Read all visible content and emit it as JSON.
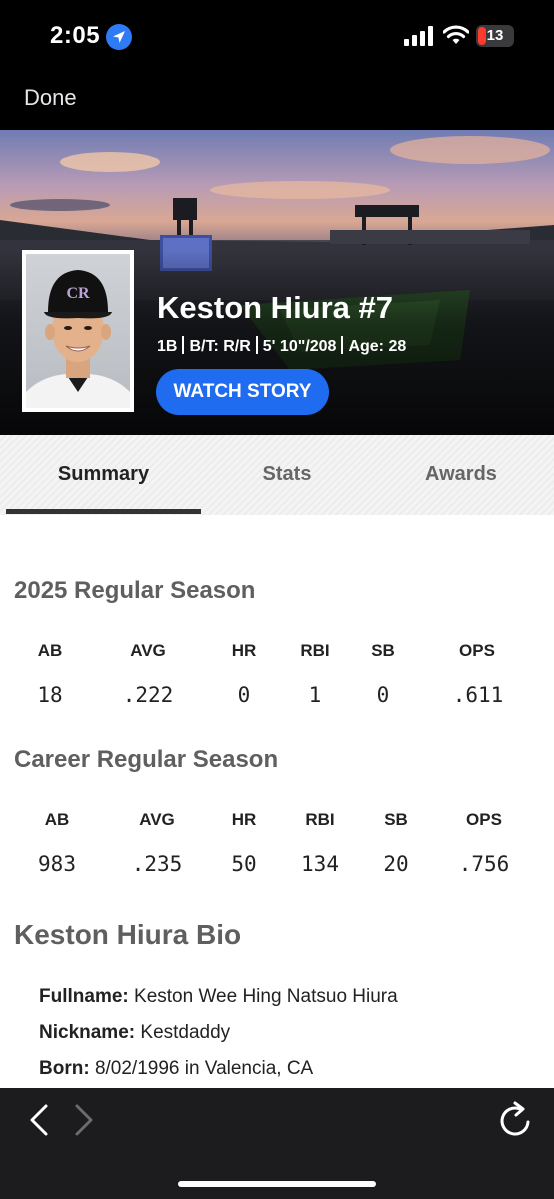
{
  "status_bar": {
    "time": "2:05",
    "battery_level": "13",
    "battery_color": "#ff3b30",
    "icons": [
      "location-arrow-icon",
      "signal-icon",
      "wifi-icon",
      "battery-icon"
    ]
  },
  "nav": {
    "done_label": "Done"
  },
  "hero": {
    "player_name": "Keston Hiura #7",
    "position": "1B",
    "bats_throws": "B/T: R/R",
    "height_weight": "5' 10\"/208",
    "age": "Age: 28",
    "watch_label": "WATCH STORY",
    "accent": "#1f6cf0",
    "cap_logo": "CR"
  },
  "tabs": [
    {
      "label": "Summary",
      "active": true
    },
    {
      "label": "Stats",
      "active": false
    },
    {
      "label": "Awards",
      "active": false
    }
  ],
  "season": {
    "title": "2025 Regular Season",
    "headers": [
      "AB",
      "AVG",
      "HR",
      "RBI",
      "SB",
      "OPS"
    ],
    "values": [
      "18",
      ".222",
      "0",
      "1",
      "0",
      ".611"
    ]
  },
  "career": {
    "title": "Career Regular Season",
    "headers": [
      "AB",
      "AVG",
      "HR",
      "RBI",
      "SB",
      "OPS"
    ],
    "values": [
      "983",
      ".235",
      "50",
      "134",
      "20",
      ".756"
    ]
  },
  "bio": {
    "title": "Keston Hiura Bio",
    "fullname_label": "Fullname:",
    "fullname": "Keston Wee Hing Natsuo Hiura",
    "nickname_label": "Nickname:",
    "nickname": "Kestdaddy",
    "born_label": "Born:",
    "born": "8/02/1996 in Valencia, CA"
  },
  "toolbar": {
    "icons": [
      "back-chevron-icon",
      "forward-chevron-icon",
      "reload-icon"
    ]
  }
}
